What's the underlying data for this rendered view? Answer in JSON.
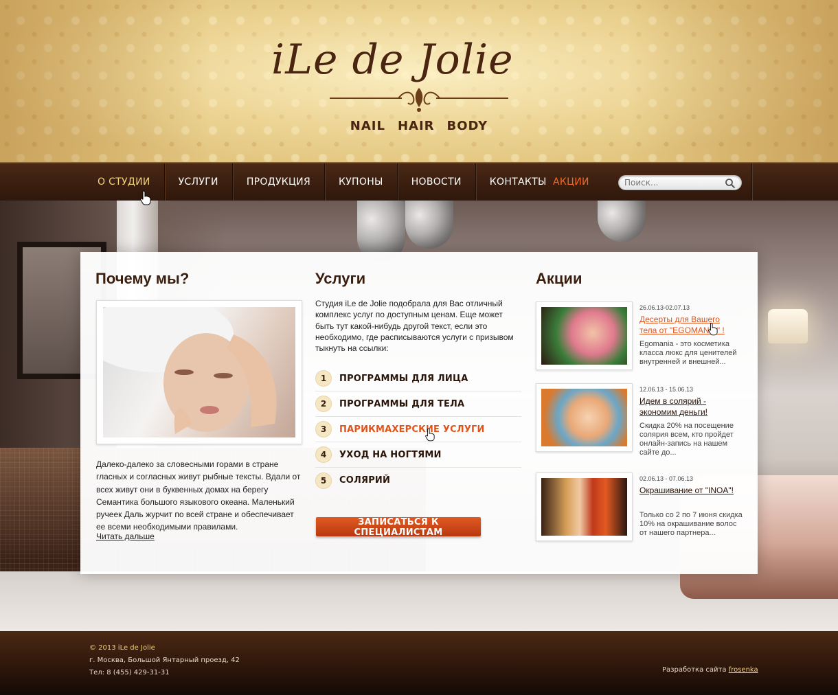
{
  "header": {
    "logo": "iLe de Jolie",
    "tagline": [
      "NAIL",
      "HAIR",
      "BODY"
    ]
  },
  "nav": {
    "items": [
      {
        "label": "О СТУДИИ",
        "state": "active"
      },
      {
        "label": "УСЛУГИ",
        "state": "normal"
      },
      {
        "label": "ПРОДУКЦИЯ",
        "state": "normal"
      },
      {
        "label": "АКЦИИ",
        "state": "highlight"
      },
      {
        "label": "КУПОНЫ",
        "state": "normal"
      },
      {
        "label": "НОВОСТИ",
        "state": "normal"
      },
      {
        "label": "КОНТАКТЫ",
        "state": "normal"
      }
    ],
    "search_placeholder": "Поиск..."
  },
  "why": {
    "title": "Почему мы?",
    "text": "Далеко-далеко за словесными горами в стране гласных и согласных живут рыбные тексты. Вдали от всех живут они в буквенных домах на берегу Семантика большого языкового океана. Маленький ручеек Даль журчит по всей стране и обеспечивает ее всеми необходимыми правилами.",
    "more_link": "Читать дальше"
  },
  "services": {
    "title": "Услуги",
    "intro": "Студия iLe de Jolie подобрала для Вас отличный комплекс услуг по доступным ценам. Еще может быть тут какой-нибудь другой текст, если это необходимо, где расписываются услуги с призывом тыкнуть на ссылки:",
    "items": [
      {
        "num": "1",
        "label": "ПРОГРАММЫ ДЛЯ ЛИЦА"
      },
      {
        "num": "2",
        "label": "ПРОГРАММЫ ДЛЯ ТЕЛА"
      },
      {
        "num": "3",
        "label": "ПАРИКМАХЕРСКИЕ УСЛУГИ"
      },
      {
        "num": "4",
        "label": "УХОД НА НОГТЯМИ"
      },
      {
        "num": "5",
        "label": "СОЛЯРИЙ"
      }
    ],
    "cta": "ЗАПИСАТЬСЯ К СПЕЦИАЛИСТАМ"
  },
  "promos": {
    "title": "Акции",
    "items": [
      {
        "date": "26.06.13-02.07.13",
        "title": "Десерты для Вашего тела от \"EGOMANIA\" !",
        "desc": "Egomania - это косметика класса люкс для ценителей внутренней и внешней..."
      },
      {
        "date": "12.06.13 - 15.06.13",
        "title": "Идем в солярий - экономим деньги!",
        "desc": "Скидка 20% на посещение солярия всем, кто пройдет онлайн-запись на нашем сайте до..."
      },
      {
        "date": "02.06.13 - 07.06.13",
        "title": "Окрашивание от \"INOA\"!",
        "desc": "Только со 2 по 7 июня скидка 10% на окрашивание волос от нашего партнера..."
      }
    ]
  },
  "footer": {
    "copyright": "© 2013 iLe de Jolie",
    "address": "г. Москва, Большой Янтарный проезд, 42",
    "phone": "Тел: 8 (455) 429-31-31",
    "dev_label": "Разработка сайта",
    "dev_link": "frosenka"
  },
  "colors": {
    "brand_brown": "#3a1e0e",
    "accent_orange": "#e0541c",
    "nav_active": "#f3d27a",
    "header_gold": "#e3c680"
  }
}
